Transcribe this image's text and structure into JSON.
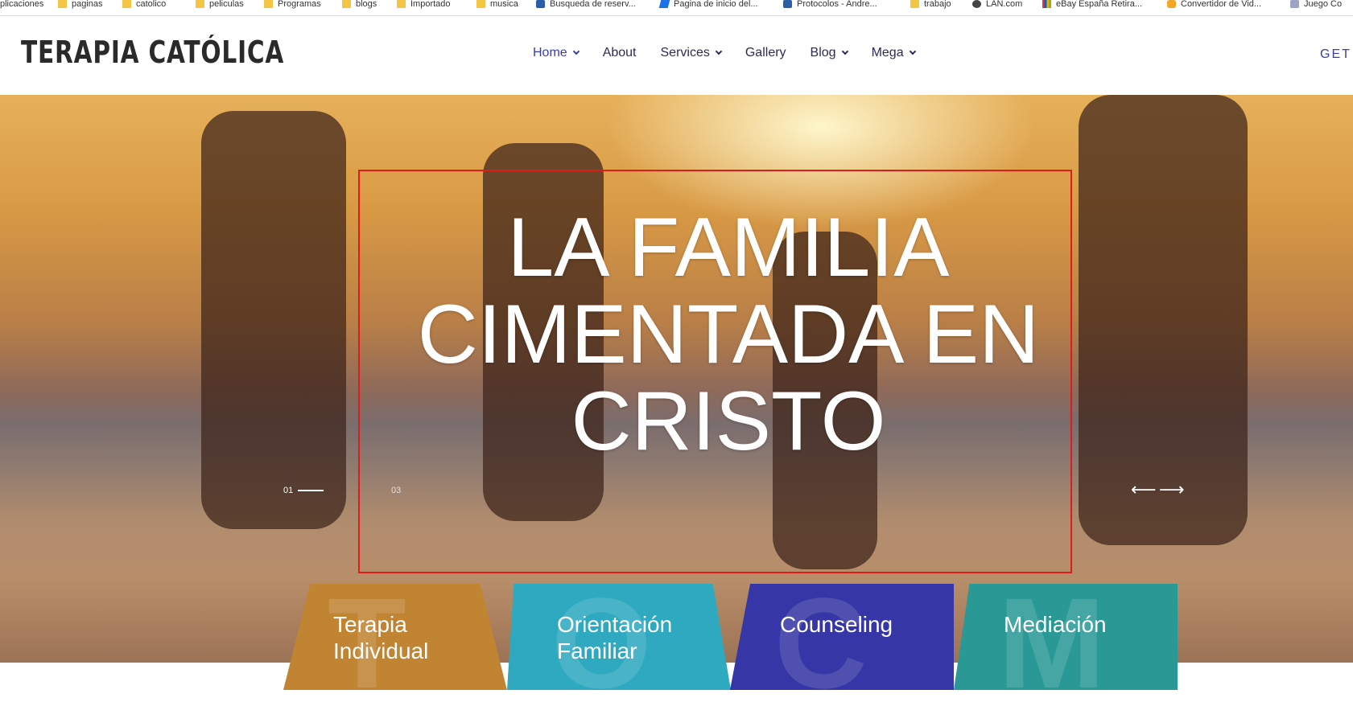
{
  "bookmarks": [
    {
      "label": "plicaciones",
      "icon": "apps-icon"
    },
    {
      "label": "paginas",
      "icon": "folder-icon"
    },
    {
      "label": "catolico",
      "icon": "folder-icon"
    },
    {
      "label": "peliculas",
      "icon": "folder-icon"
    },
    {
      "label": "Programas",
      "icon": "folder-icon"
    },
    {
      "label": "blogs",
      "icon": "folder-icon"
    },
    {
      "label": "Importado",
      "icon": "folder-icon"
    },
    {
      "label": "musica",
      "icon": "folder-icon"
    },
    {
      "label": "Busqueda de reserv...",
      "icon": "site-icon"
    },
    {
      "label": "Pagina de inicio del...",
      "icon": "paypal-icon"
    },
    {
      "label": "Protocolos - Andre...",
      "icon": "site-icon"
    },
    {
      "label": "trabajo",
      "icon": "folder-icon"
    },
    {
      "label": "LAN.com",
      "icon": "lan-icon"
    },
    {
      "label": "eBay España Retira...",
      "icon": "ebay-icon"
    },
    {
      "label": "Convertidor de Vid...",
      "icon": "converter-icon"
    },
    {
      "label": "Juego Co",
      "icon": "game-icon"
    }
  ],
  "header": {
    "logo": "TERAPIA CATÓLICA",
    "nav": [
      {
        "label": "Home",
        "dropdown": true,
        "active": true
      },
      {
        "label": "About",
        "dropdown": false
      },
      {
        "label": "Services",
        "dropdown": true
      },
      {
        "label": "Gallery",
        "dropdown": false
      },
      {
        "label": "Blog",
        "dropdown": true
      },
      {
        "label": "Mega",
        "dropdown": true
      }
    ],
    "cta": "GET"
  },
  "hero": {
    "title_lines": [
      "LA FAMILIA",
      "CIMENTADA EN",
      "CRISTO"
    ],
    "slide_current": "01",
    "slide_total": "03",
    "prev_arrow": "⟵",
    "next_arrow": "⟶"
  },
  "services": [
    {
      "letter": "T",
      "label_lines": [
        "Terapia",
        "Individual"
      ],
      "color": "#c08432"
    },
    {
      "letter": "O",
      "label_lines": [
        "Orientación",
        "Familiar"
      ],
      "color": "#2fa9bf"
    },
    {
      "letter": "C",
      "label_lines": [
        "Counseling"
      ],
      "color": "#3736a6"
    },
    {
      "letter": "M",
      "label_lines": [
        "Mediación"
      ],
      "color": "#2a9996"
    }
  ],
  "colors": {
    "accent": "#3b3dac",
    "frame": "#e01b1b"
  }
}
